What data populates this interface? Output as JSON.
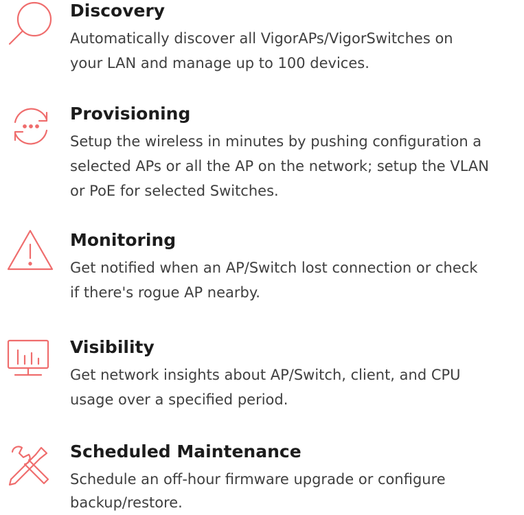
{
  "accent_color": "#ef6d6d",
  "features": [
    {
      "icon": "search-icon",
      "title": "Discovery",
      "lines": [
        "Automatically discover all VigorAPs/VigorSwitches on",
        "your LAN and manage up to 100 devices."
      ]
    },
    {
      "icon": "sync-icon",
      "title": "Provisioning",
      "lines": [
        "Setup the wireless in minutes by pushing configuration a",
        "selected APs or all the AP on the network; setup the VLAN",
        "or PoE for selected Switches."
      ]
    },
    {
      "icon": "warning-icon",
      "title": "Monitoring",
      "lines": [
        "Get notified when an AP/Switch lost connection or check",
        "if there's rogue AP nearby."
      ]
    },
    {
      "icon": "monitor-chart-icon",
      "title": "Visibility",
      "lines": [
        "Get network insights about AP/Switch, client, and CPU",
        "usage over a specified period."
      ]
    },
    {
      "icon": "tools-icon",
      "title": "Scheduled Maintenance",
      "lines": [
        "Schedule an off-hour firmware upgrade or configure",
        "backup/restore."
      ]
    }
  ]
}
